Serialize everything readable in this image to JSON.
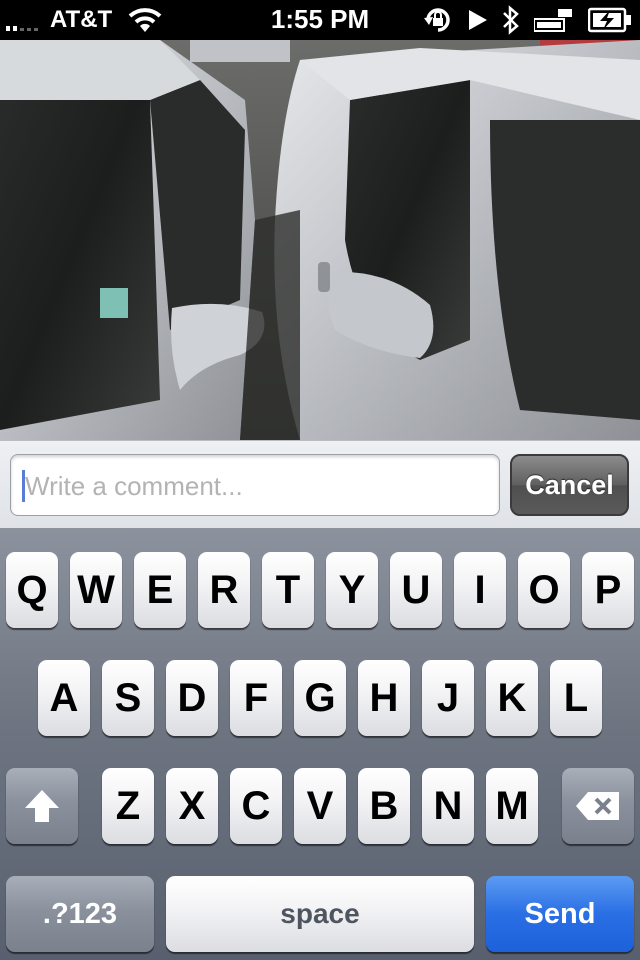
{
  "status_bar": {
    "carrier": "AT&T",
    "time": "1:55 PM",
    "icons": [
      "signal-icon",
      "wifi-icon",
      "rotation-lock-icon",
      "play-icon",
      "bluetooth-icon",
      "battery-charging-icon"
    ]
  },
  "photo": {
    "description_icon": "photo-icon"
  },
  "comment": {
    "placeholder": "Write a comment...",
    "value": "",
    "cancel_label": "Cancel"
  },
  "keyboard": {
    "row1": [
      "Q",
      "W",
      "E",
      "R",
      "T",
      "Y",
      "U",
      "I",
      "O",
      "P"
    ],
    "row2": [
      "A",
      "S",
      "D",
      "F",
      "G",
      "H",
      "J",
      "K",
      "L"
    ],
    "row3": [
      "Z",
      "X",
      "C",
      "V",
      "B",
      "N",
      "M"
    ],
    "numbers_label": ".?123",
    "space_label": "space",
    "send_label": "Send"
  },
  "colors": {
    "send_blue": "#2a6fe4",
    "cancel_gray": "#5f5f5f",
    "keyboard_bg": "#6e7581"
  }
}
